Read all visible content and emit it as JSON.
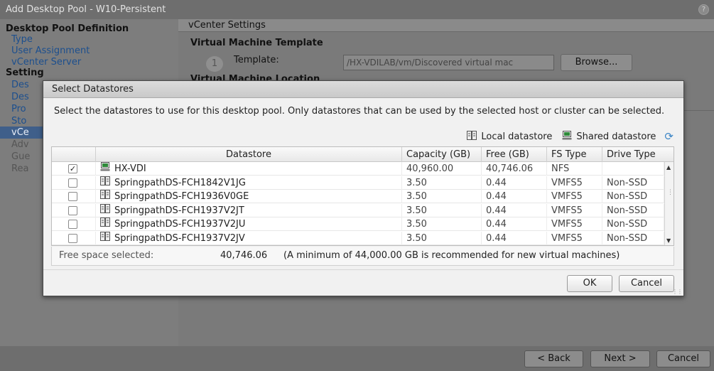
{
  "window": {
    "title": "Add Desktop Pool - W10-Persistent",
    "help_label": "?"
  },
  "sidebar": {
    "sections": [
      {
        "heading": "Desktop Pool Definition",
        "items": [
          {
            "label": "Type"
          },
          {
            "label": "User Assignment"
          },
          {
            "label": "vCenter Server"
          }
        ]
      },
      {
        "heading": "Setting",
        "items": [
          {
            "label": "Des"
          },
          {
            "label": "Des"
          },
          {
            "label": "Pro"
          },
          {
            "label": "Sto"
          },
          {
            "label": "vCe"
          },
          {
            "label": "Adv"
          },
          {
            "label": "Gue"
          },
          {
            "label": "Rea"
          }
        ]
      }
    ]
  },
  "main": {
    "tab_label": "vCenter Settings",
    "vm_template_heading": "Virtual Machine Template",
    "step_number": "1",
    "template_label": "Template:",
    "template_value": "/HX-VDILAB/vm/Discovered virtual mac",
    "browse_label": "Browse...",
    "vm_location_heading": "Virtual Machine Location"
  },
  "dialog": {
    "title": "Select Datastores",
    "description": "Select the datastores to use for this desktop pool. Only datastores that can be used by the selected host or cluster can be selected.",
    "legend": {
      "local": "Local datastore",
      "shared": "Shared datastore"
    },
    "columns": [
      "Datastore",
      "Capacity (GB)",
      "Free (GB)",
      "FS Type",
      "Drive Type"
    ],
    "rows": [
      {
        "checked": true,
        "kind": "shared",
        "name": "HX-VDI",
        "capacity": "40,960.00",
        "free": "40,746.06",
        "fs": "NFS",
        "drive": ""
      },
      {
        "checked": false,
        "kind": "local",
        "name": "SpringpathDS-FCH1842V1JG",
        "capacity": "3.50",
        "free": "0.44",
        "fs": "VMFS5",
        "drive": "Non-SSD"
      },
      {
        "checked": false,
        "kind": "local",
        "name": "SpringpathDS-FCH1936V0GE",
        "capacity": "3.50",
        "free": "0.44",
        "fs": "VMFS5",
        "drive": "Non-SSD"
      },
      {
        "checked": false,
        "kind": "local",
        "name": "SpringpathDS-FCH1937V2JT",
        "capacity": "3.50",
        "free": "0.44",
        "fs": "VMFS5",
        "drive": "Non-SSD"
      },
      {
        "checked": false,
        "kind": "local",
        "name": "SpringpathDS-FCH1937V2JU",
        "capacity": "3.50",
        "free": "0.44",
        "fs": "VMFS5",
        "drive": "Non-SSD"
      },
      {
        "checked": false,
        "kind": "local",
        "name": "SpringpathDS-FCH1937V2JV",
        "capacity": "3.50",
        "free": "0.44",
        "fs": "VMFS5",
        "drive": "Non-SSD"
      }
    ],
    "free_space_label": "Free space selected:",
    "free_space_value": "40,746.06",
    "free_space_note": "(A minimum of 44,000.00 GB is recommended for new virtual machines)",
    "ok_label": "OK",
    "cancel_label": "Cancel"
  },
  "footer": {
    "back_label": "< Back",
    "next_label": "Next >",
    "cancel_label": "Cancel"
  },
  "colors": {
    "link": "#1c4f8e",
    "selected": "#3f5f8a",
    "refresh": "#3d86c6",
    "shared_icon": "#2f8a3a"
  }
}
